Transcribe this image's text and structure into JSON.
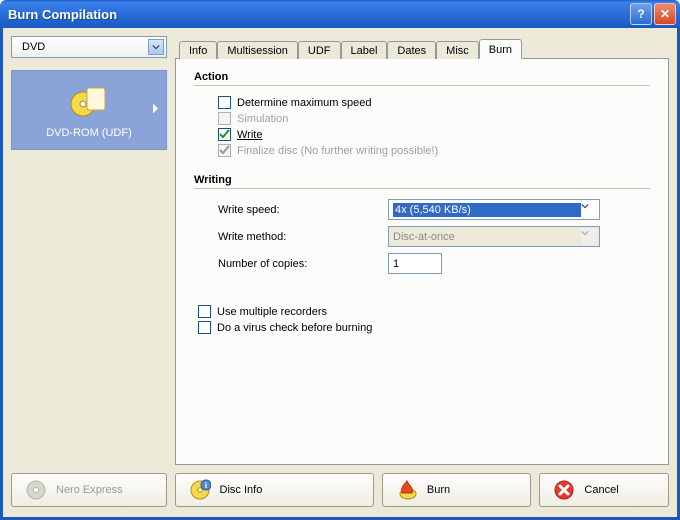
{
  "window": {
    "title": "Burn Compilation"
  },
  "sidebar": {
    "media_type": "DVD",
    "tile_label": "DVD-ROM (UDF)"
  },
  "tabs": [
    {
      "label": "Info",
      "active": false
    },
    {
      "label": "Multisession",
      "active": false
    },
    {
      "label": "UDF",
      "active": false
    },
    {
      "label": "Label",
      "active": false
    },
    {
      "label": "Dates",
      "active": false
    },
    {
      "label": "Misc",
      "active": false
    },
    {
      "label": "Burn",
      "active": true
    }
  ],
  "burn_panel": {
    "action_heading": "Action",
    "writing_heading": "Writing",
    "checks": {
      "determine_max": {
        "label": "Determine maximum speed",
        "checked": false,
        "enabled": true
      },
      "simulation": {
        "label": "Simulation",
        "checked": false,
        "enabled": false
      },
      "write": {
        "label": "Write",
        "checked": true,
        "enabled": true
      },
      "finalize": {
        "label": "Finalize disc (No further writing possible!)",
        "checked": true,
        "enabled": false
      },
      "multi_rec": {
        "label": "Use multiple recorders",
        "checked": false,
        "enabled": true
      },
      "virus_check": {
        "label": "Do a virus check before burning",
        "checked": false,
        "enabled": true
      }
    },
    "fields": {
      "write_speed": {
        "label": "Write speed:",
        "value": "4x (5,540 KB/s)",
        "enabled": true
      },
      "write_method": {
        "label": "Write method:",
        "value": "Disc-at-once",
        "enabled": false
      },
      "num_copies": {
        "label": "Number of copies:",
        "value": "1"
      }
    }
  },
  "buttons": {
    "nero_express": "Nero Express",
    "disc_info": "Disc Info",
    "burn": "Burn",
    "cancel": "Cancel"
  },
  "colors": {
    "titlebar_top": "#2a6fdc",
    "tile_bg": "#8aa3d8",
    "select_highlight": "#316ac5"
  }
}
